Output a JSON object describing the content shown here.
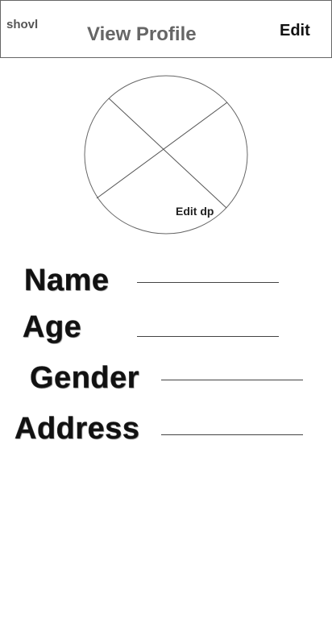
{
  "header": {
    "app_name": "shovl",
    "title": "View Profile",
    "edit_label": "Edit"
  },
  "avatar": {
    "edit_dp_label": "Edit dp"
  },
  "fields": {
    "name_label": "Name",
    "age_label": "Age",
    "gender_label": "Gender",
    "address_label": "Address"
  }
}
